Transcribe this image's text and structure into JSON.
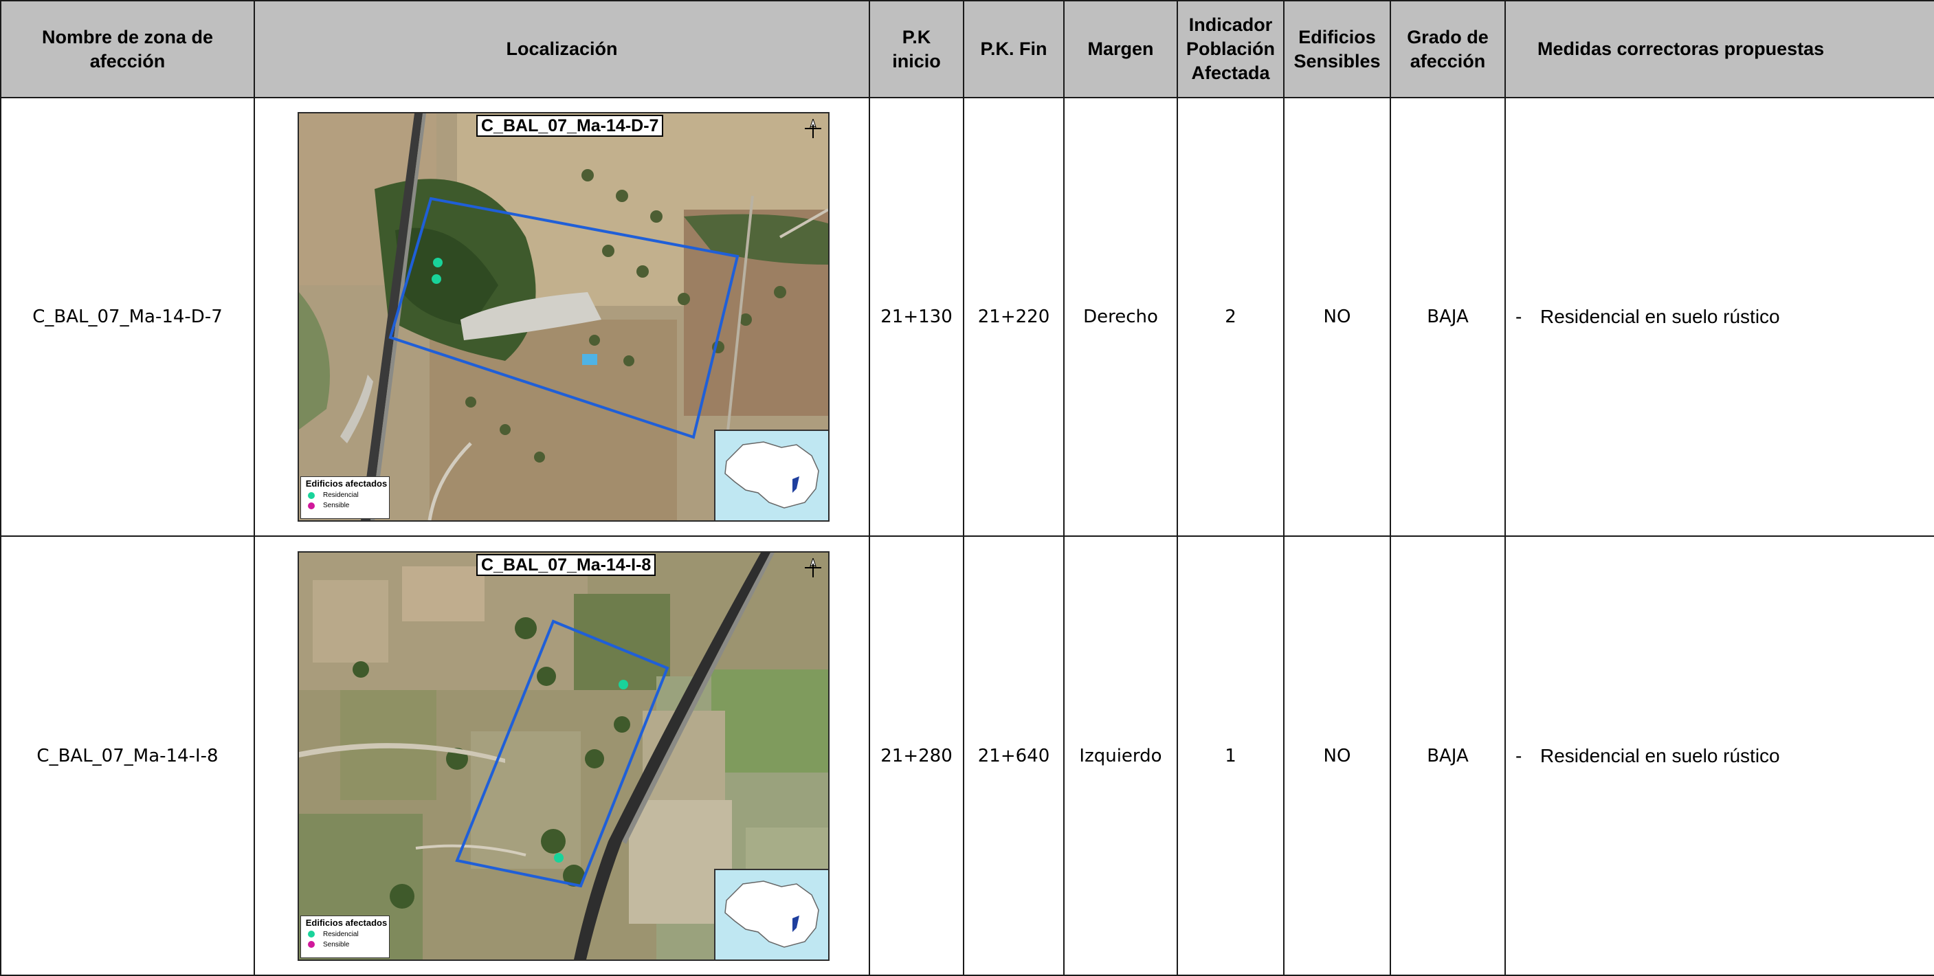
{
  "headers": {
    "zona_line1": "Nombre de zona de",
    "zona_line2": "afección",
    "localizacion": "Localización",
    "pk_inicio_line1": "P.K",
    "pk_inicio_line2": "inicio",
    "pk_fin": "P.K. Fin",
    "margen": "Margen",
    "indicador_line1": "Indicador",
    "indicador_line2": "Población",
    "indicador_line3": "Afectada",
    "edificios_line1": "Edificios",
    "edificios_line2": "Sensibles",
    "grado_line1": "Grado de",
    "grado_line2": "afección",
    "medidas": "Medidas correctoras propuestas"
  },
  "legend": {
    "title": "Edificios afectados",
    "residencial": "Residencial",
    "sensible": "Sensible",
    "residencial_color": "#19d39a",
    "sensible_color": "#d0189a"
  },
  "colors": {
    "header_bg": "#bfbfbf",
    "zone_outline": "#1f5fd8",
    "railway": "#3a3a3a"
  },
  "rows": [
    {
      "zona": "C_BAL_07_Ma-14-D-7",
      "map_label": "C_BAL_07_Ma-14-D-7",
      "pk_inicio": "21+130",
      "pk_fin": "21+220",
      "margen": "Derecho",
      "indicador": "2",
      "edificios_sensibles": "NO",
      "grado": "BAJA",
      "medida_dash": "-",
      "medida": "Residencial en suelo rústico"
    },
    {
      "zona": "C_BAL_07_Ma-14-I-8",
      "map_label": "C_BAL_07_Ma-14-I-8",
      "pk_inicio": "21+280",
      "pk_fin": "21+640",
      "margen": "Izquierdo",
      "indicador": "1",
      "edificios_sensibles": "NO",
      "grado": "BAJA",
      "medida_dash": "-",
      "medida": "Residencial en suelo rústico"
    }
  ]
}
